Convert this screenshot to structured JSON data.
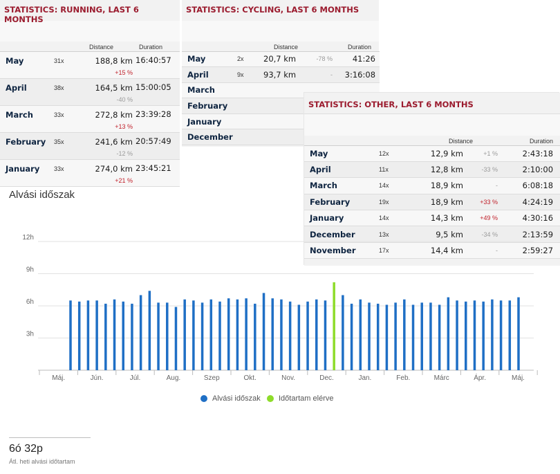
{
  "running": {
    "title": "STATISTICS: RUNNING, LAST 6 MONTHS",
    "headers": {
      "distance": "Distance",
      "duration": "Duration"
    },
    "rows": [
      {
        "month": "May",
        "count": "31x",
        "distance": "188,8 km",
        "change": "+15 %",
        "change_type": "pos",
        "duration": "16:40:57"
      },
      {
        "month": "April",
        "count": "38x",
        "distance": "164,5 km",
        "change": "-40 %",
        "change_type": "neg",
        "duration": "15:00:05"
      },
      {
        "month": "March",
        "count": "33x",
        "distance": "272,8 km",
        "change": "+13 %",
        "change_type": "pos",
        "duration": "23:39:28"
      },
      {
        "month": "February",
        "count": "35x",
        "distance": "241,6 km",
        "change": "-12 %",
        "change_type": "neg",
        "duration": "20:57:49"
      },
      {
        "month": "January",
        "count": "33x",
        "distance": "274,0 km",
        "change": "+21 %",
        "change_type": "pos",
        "duration": "23:45:21"
      }
    ]
  },
  "cycling": {
    "title": "STATISTICS: CYCLING, LAST 6 MONTHS",
    "headers": {
      "distance": "Distance",
      "duration": "Duration"
    },
    "rows": [
      {
        "month": "May",
        "count": "2x",
        "distance": "20,7 km",
        "change": "-78 %",
        "change_type": "neg",
        "duration": "41:26"
      },
      {
        "month": "April",
        "count": "9x",
        "distance": "93,7 km",
        "change": "-",
        "change_type": "dash",
        "duration": "3:16:08"
      },
      {
        "month": "March"
      },
      {
        "month": "February"
      },
      {
        "month": "January"
      },
      {
        "month": "December"
      }
    ]
  },
  "other": {
    "title": "STATISTICS: OTHER, LAST 6 MONTHS",
    "headers": {
      "distance": "Distance",
      "duration": "Duration"
    },
    "rows": [
      {
        "month": "May",
        "count": "12x",
        "distance": "12,9 km",
        "change": "+1 %",
        "change_type": "neg",
        "duration": "2:43:18"
      },
      {
        "month": "April",
        "count": "11x",
        "distance": "12,8 km",
        "change": "-33 %",
        "change_type": "neg",
        "duration": "2:10:00"
      },
      {
        "month": "March",
        "count": "14x",
        "distance": "18,9 km",
        "change": "-",
        "change_type": "dash",
        "duration": "6:08:18"
      },
      {
        "month": "February",
        "count": "19x",
        "distance": "18,9 km",
        "change": "+33 %",
        "change_type": "pos",
        "duration": "4:24:19"
      },
      {
        "month": "January",
        "count": "14x",
        "distance": "14,3 km",
        "change": "+49 %",
        "change_type": "pos",
        "duration": "4:30:16"
      },
      {
        "month": "December",
        "count": "13x",
        "distance": "9,5 km",
        "change": "-34 %",
        "change_type": "neg",
        "duration": "2:13:59"
      },
      {
        "month": "November",
        "count": "17x",
        "distance": "14,4 km",
        "change": "-",
        "change_type": "dash",
        "duration": "2:59:27"
      }
    ]
  },
  "sleep": {
    "title": "Alvási időszak",
    "legend": [
      {
        "label": "Alvási időszak",
        "color": "#1f6fc5"
      },
      {
        "label": "Időtartam elérve",
        "color": "#8edc2a"
      }
    ],
    "summary_value": "6ó 32p",
    "summary_label": "Átl. heti alvási időtartam"
  },
  "chart_data": {
    "type": "bar",
    "title": "Alvási időszak",
    "y_ticks": [
      "3h",
      "6h",
      "9h",
      "12h"
    ],
    "ylim": [
      0,
      12
    ],
    "y_unit": "hours",
    "x_tick_labels": [
      "Máj.",
      "Jún.",
      "Júl.",
      "Aug.",
      "Szep",
      "Okt.",
      "Nov.",
      "Dec.",
      "Jan.",
      "Feb.",
      "Márc",
      "Ápr.",
      "Máj."
    ],
    "series": [
      {
        "name": "Alvási időszak",
        "color": "#1f6fc5",
        "values": [
          6.5,
          6.4,
          6.5,
          6.5,
          6.2,
          6.6,
          6.4,
          6.2,
          7.0,
          7.4,
          6.3,
          6.3,
          5.9,
          6.6,
          6.5,
          6.3,
          6.6,
          6.4,
          6.7,
          6.6,
          6.7,
          6.2,
          7.2,
          6.7,
          6.6,
          6.4,
          6.1,
          6.4,
          6.6,
          6.5,
          8.2,
          7.0,
          6.2,
          6.6,
          6.3,
          6.2,
          6.1,
          6.3,
          6.6,
          6.1,
          6.3,
          6.3,
          6.1,
          6.8,
          6.5,
          6.4,
          6.5,
          6.4,
          6.6,
          6.5,
          6.5,
          6.8
        ]
      }
    ],
    "highlight": {
      "name": "Időtartam elérve",
      "index": 30,
      "color": "#8edc2a"
    },
    "legend_position": "bottom",
    "grid": true
  }
}
